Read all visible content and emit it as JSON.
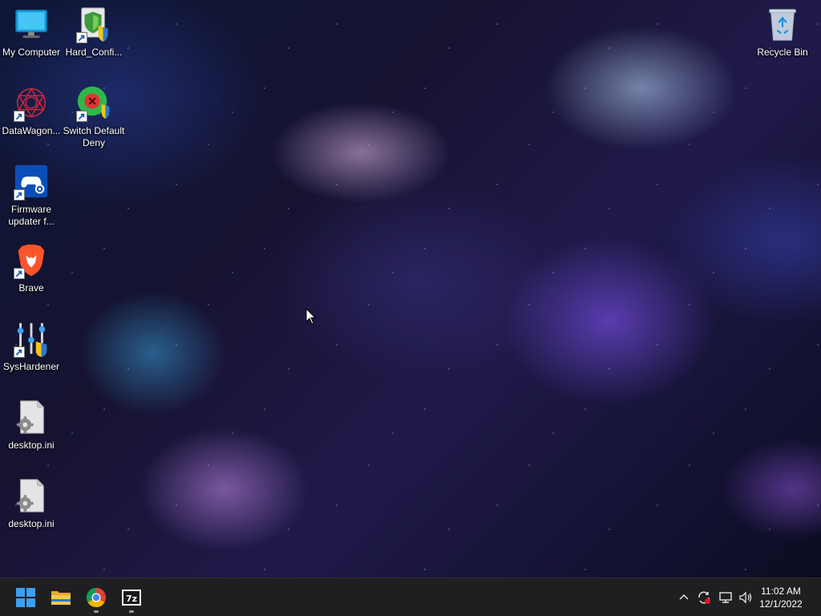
{
  "desktop": {
    "icons": [
      {
        "label": "My Computer",
        "icon": "monitor-icon",
        "shortcut": false
      },
      {
        "label": "Hard_Confi...",
        "icon": "shield-icon",
        "shortcut": true
      },
      {
        "label": "DataWagon...",
        "icon": "datawagon-icon",
        "shortcut": true
      },
      {
        "label": "Switch Default Deny",
        "icon": "switch-default-deny-icon",
        "shortcut": true
      },
      {
        "label": "Firmware updater f...",
        "icon": "gamepad-icon",
        "shortcut": true
      },
      {
        "label": "Brave",
        "icon": "brave-lion-icon",
        "shortcut": true
      },
      {
        "label": "SysHardener",
        "icon": "sliders-shield-icon",
        "shortcut": true
      },
      {
        "label": "desktop.ini",
        "icon": "settings-file-icon",
        "shortcut": false
      },
      {
        "label": "desktop.ini",
        "icon": "settings-file-icon",
        "shortcut": false
      },
      {
        "label": "Recycle Bin",
        "icon": "recycle-bin-icon",
        "shortcut": false
      }
    ]
  },
  "taskbar": {
    "pinned": [
      {
        "name": "Start",
        "icon": "windows-start-icon",
        "running": false
      },
      {
        "name": "File Explorer",
        "icon": "folder-icon",
        "running": false
      },
      {
        "name": "Google Chrome",
        "icon": "chrome-icon",
        "running": true
      },
      {
        "name": "7-Zip",
        "icon": "7zip-icon",
        "running": true
      }
    ],
    "tray": {
      "icons": [
        "chevron-up-icon",
        "sync-alert-icon",
        "network-icon",
        "volume-icon"
      ]
    },
    "clock": {
      "time": "11:02 AM",
      "date": "12/1/2022"
    }
  },
  "colors": {
    "taskbar_bg": "#1f1f22",
    "start_blue": "#3ea0f0",
    "brave_orange": "#fb542b"
  }
}
